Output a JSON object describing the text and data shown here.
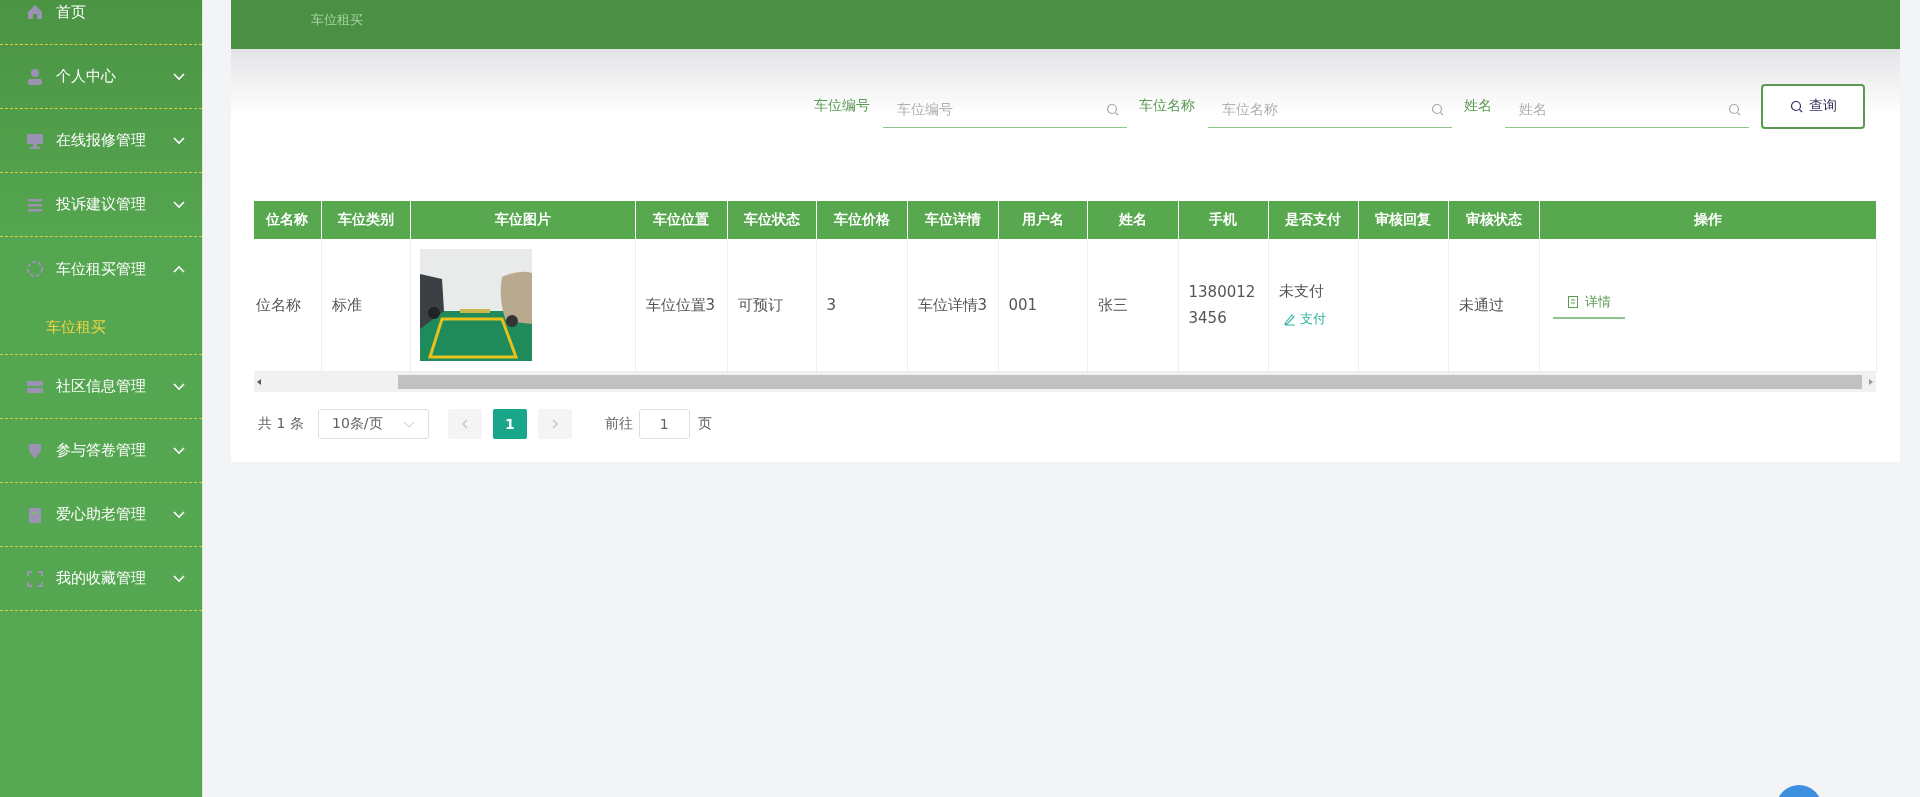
{
  "sidebar": {
    "items": [
      {
        "label": "首页",
        "kind": "link"
      },
      {
        "label": "个人中心",
        "kind": "menu",
        "expanded": false
      },
      {
        "label": "在线报修管理",
        "kind": "menu",
        "expanded": false
      },
      {
        "label": "投诉建议管理",
        "kind": "menu",
        "expanded": false
      },
      {
        "label": "车位租买管理",
        "kind": "menu",
        "expanded": true,
        "children": [
          {
            "label": "车位租买",
            "selected": true
          }
        ]
      },
      {
        "label": "社区信息管理",
        "kind": "menu",
        "expanded": false
      },
      {
        "label": "参与答卷管理",
        "kind": "menu",
        "expanded": false
      },
      {
        "label": "爱心助老管理",
        "kind": "menu",
        "expanded": false
      },
      {
        "label": "我的收藏管理",
        "kind": "menu",
        "expanded": false
      }
    ]
  },
  "header": {
    "breadcrumb": "车位租买"
  },
  "search": {
    "fields": [
      {
        "label": "车位编号",
        "placeholder": "车位编号"
      },
      {
        "label": "车位名称",
        "placeholder": "车位名称"
      },
      {
        "label": "姓名",
        "placeholder": "姓名"
      }
    ],
    "button": "查询"
  },
  "table": {
    "columns": [
      "位名称",
      "车位类别",
      "车位图片",
      "车位位置",
      "车位状态",
      "车位价格",
      "车位详情",
      "用户名",
      "姓名",
      "手机",
      "是否支付",
      "审核回复",
      "审核状态",
      "操作"
    ],
    "rows": [
      {
        "cells": [
          {
            "kind": "text",
            "text": "位名称"
          },
          {
            "kind": "text",
            "text": "标准"
          },
          {
            "kind": "picture"
          },
          {
            "kind": "text",
            "text": "车位位置3"
          },
          {
            "kind": "text",
            "text": "可预订"
          },
          {
            "kind": "text",
            "text": "3"
          },
          {
            "kind": "text",
            "text": "车位详情3"
          },
          {
            "kind": "text",
            "text": "001"
          },
          {
            "kind": "text",
            "text": "张三"
          },
          {
            "kind": "text",
            "text": "13800123456"
          },
          {
            "kind": "pay",
            "text": "未支付",
            "action": "支付"
          },
          {
            "kind": "text",
            "text": ""
          },
          {
            "kind": "text",
            "text": "未通过"
          },
          {
            "kind": "actions",
            "action": "详情"
          }
        ]
      }
    ]
  },
  "pagination": {
    "total": "共 1 条",
    "page_size": "10条/页",
    "pages": [
      {
        "label": "1",
        "selected": true
      }
    ],
    "goto_label": "前往",
    "goto_value": "1",
    "page_suffix": "页"
  }
}
